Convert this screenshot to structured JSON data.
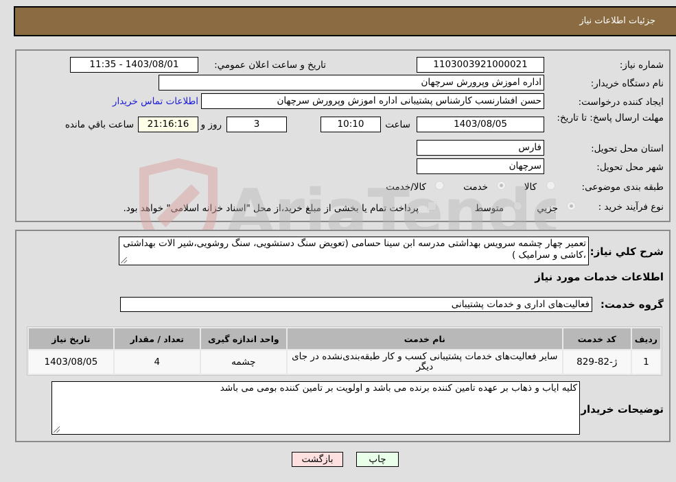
{
  "header": {
    "title": "جزئیات اطلاعات نیاز"
  },
  "details": {
    "need_number_label": "شماره نیاز:",
    "need_number": "1103003921000021",
    "announce_label": "تاريخ و ساعت اعلان عمومي:",
    "announce_value": "1403/08/01 - 11:35",
    "buyer_org_label": "نام دستگاه خریدار:",
    "buyer_org": "اداره اموزش وپرورش سرچهان",
    "requester_label": "ایجاد کننده درخواست:",
    "requester": "حسن افشارنسب کارشناس پشتیبانی اداره اموزش وپرورش سرچهان",
    "contact_link": "اطلاعات تماس خریدار",
    "deadline_label": "مهلت ارسال پاسخ: تا تاریخ:",
    "deadline_date": "1403/08/05",
    "time_label": "ساعت",
    "deadline_time": "10:10",
    "days_value": "3",
    "days_label": "روز و",
    "remaining_time": "21:16:16",
    "remaining_label": "ساعت باقي مانده",
    "province_label": "استان محل تحویل:",
    "province": "فارس",
    "city_label": "شهر محل تحویل:",
    "city": "سرچهان",
    "category_label": "طبقه بندی موضوعی:",
    "category_options": [
      {
        "label": "کالا",
        "checked": false
      },
      {
        "label": "خدمت",
        "checked": true
      },
      {
        "label": "کالا/خدمت",
        "checked": false
      }
    ],
    "process_label": "نوع فرآیند خرید :",
    "process_options": [
      {
        "label": "جزيي",
        "checked": true
      },
      {
        "label": "متوسط",
        "checked": false
      }
    ],
    "payment_note": "پرداخت تمام یا بخشی از مبلغ خرید،از محل \"اسناد خزانه اسلامی\" خواهد بود."
  },
  "summary": {
    "label": "شرح کلي نياز:",
    "text": "تعمیر چهار چشمه سرویس بهداشتی مدرسه ابن سینا حسامی (تعویض سنگ دستشویی، سنگ روشویی،شیر الات بهداشتی ،کاشی و سرامیک )"
  },
  "services": {
    "section_title": "اطلاعات خدمات مورد نیاز",
    "group_label": "گروه خدمت:",
    "group_value": "فعالیت‌های اداری و خدمات پشتیبانی",
    "table": {
      "headers": [
        "ردیف",
        "کد خدمت",
        "نام خدمت",
        "واحد اندازه گیری",
        "تعداد / مقدار",
        "تاریخ نیاز"
      ],
      "rows": [
        [
          "1",
          "ژ-82-829",
          "سایر فعالیت‌های خدمات پشتیبانی کسب و کار طبقه‌بندی‌نشده در جای دیگر",
          "چشمه",
          "4",
          "1403/08/05"
        ]
      ]
    }
  },
  "buyer_notes": {
    "label": "توضیحات خریدار:",
    "text": "کلیه ایاب و ذهاب بر عهده تامین کننده برنده می باشد و اولویت بر تامین کننده بومی می باشد"
  },
  "buttons": {
    "print": "چاپ",
    "back": "بازگشت"
  },
  "watermark": {
    "text": "AriaTender.neT"
  }
}
